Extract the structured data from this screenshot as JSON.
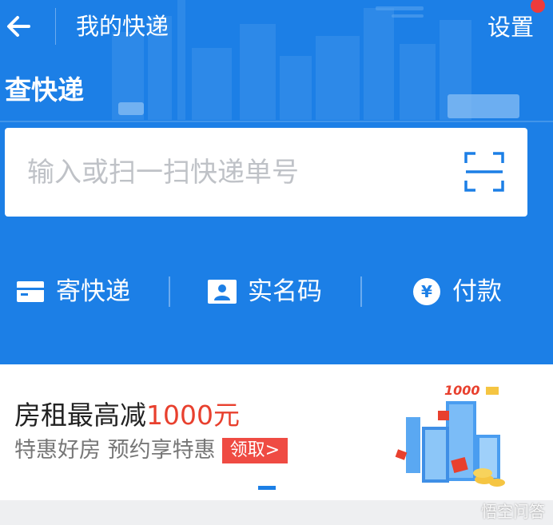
{
  "header": {
    "title": "我的快递",
    "settings_label": "设置"
  },
  "query": {
    "section_title": "查快递",
    "placeholder": "输入或扫一扫快递单号"
  },
  "actions": [
    {
      "label": "寄快递",
      "icon": "parcel-icon"
    },
    {
      "label": "实名码",
      "icon": "id-card-icon"
    },
    {
      "label": "付款",
      "icon": "yuan-icon",
      "icon_text": "¥"
    }
  ],
  "banner": {
    "title_prefix": "房租最高减",
    "title_highlight": "1000元",
    "subtitle": "特惠好房 预约享特惠",
    "claim_label": "领取>",
    "badge_number": "1000"
  },
  "watermark": "悟空问答",
  "colors": {
    "primary": "#1c7fe6",
    "highlight": "#e8402e",
    "claim_bg": "#ef4b43"
  }
}
